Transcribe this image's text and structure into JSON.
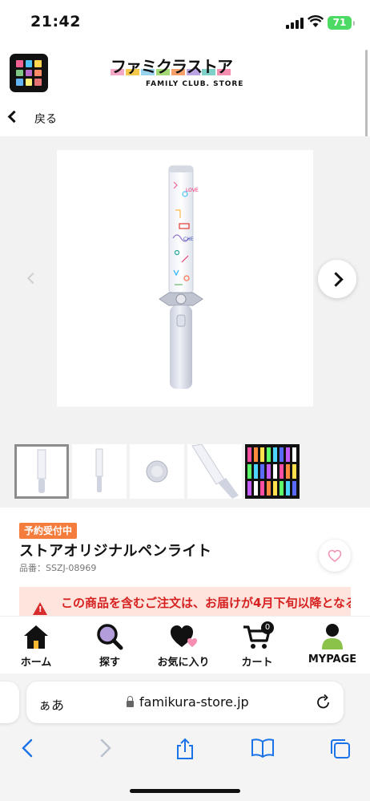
{
  "status_bar": {
    "time": "21:42",
    "battery": "71"
  },
  "header": {
    "logo_text": "ファミクラストア",
    "logo_subtitle": "FAMILY CLUB. STORE",
    "logo_colors": [
      "#f4a7c6",
      "#f2c94c",
      "#9ad3f0",
      "#a3d977",
      "#f59f6a",
      "#b9a3e3",
      "#7fd1c7",
      "#f48fb1"
    ],
    "grid_colors": [
      "#f06292",
      "#4fc3f7",
      "#ffd54f",
      "#81c784",
      "#ba68c8",
      "#ff8a65",
      "#64b5f6",
      "#fff176",
      "#e57373"
    ]
  },
  "back": {
    "label": "戻る"
  },
  "product": {
    "badge": "予約受付中",
    "name": "ストアオリジナルペンライト",
    "code": "品番：SSZJ-08969",
    "notice": "この商品を含むご注文は、お届けが4月下旬以降となる"
  },
  "thumbnails": [
    {
      "name": "thumb-penlight-front",
      "active": true
    },
    {
      "name": "thumb-penlight-small",
      "active": false
    },
    {
      "name": "thumb-penlight-button",
      "active": false
    },
    {
      "name": "thumb-penlight-angle",
      "active": false
    },
    {
      "name": "thumb-penlight-colors",
      "active": false
    }
  ],
  "tabbar": {
    "items": [
      {
        "label": "ホーム",
        "icon": "home-icon"
      },
      {
        "label": "探す",
        "icon": "search-icon"
      },
      {
        "label": "お気に入り",
        "icon": "heart-icon"
      },
      {
        "label": "カート",
        "icon": "cart-icon",
        "count": "0"
      },
      {
        "label": "MYPAGE",
        "icon": "user-icon"
      }
    ]
  },
  "browser": {
    "aa": "ぁあ",
    "url": "famikura-store.jp"
  }
}
